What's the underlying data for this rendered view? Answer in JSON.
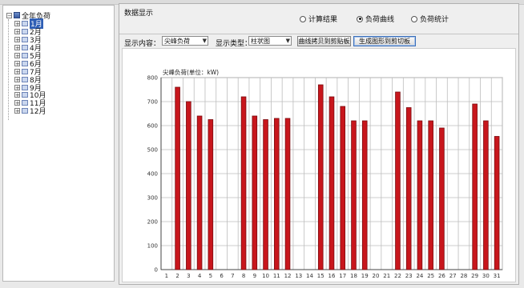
{
  "tree": {
    "root_label": "全年负荷",
    "items": [
      {
        "label": "1月"
      },
      {
        "label": "2月"
      },
      {
        "label": "3月"
      },
      {
        "label": "4月"
      },
      {
        "label": "5月"
      },
      {
        "label": "6月"
      },
      {
        "label": "7月"
      },
      {
        "label": "8月"
      },
      {
        "label": "9月"
      },
      {
        "label": "10月"
      },
      {
        "label": "11月"
      },
      {
        "label": "12月"
      }
    ],
    "selected_index": 0
  },
  "main": {
    "title": "数据显示",
    "radios": [
      {
        "label": "计算结果",
        "checked": false
      },
      {
        "label": "负荷曲线",
        "checked": true
      },
      {
        "label": "负荷统计",
        "checked": false
      }
    ],
    "toolbar": {
      "content_label": "显示内容：",
      "content_value": "尖峰负荷",
      "type_label": "显示类型：",
      "type_value": "柱状图",
      "copy_button": "曲线拷贝到剪贴板",
      "generate_button": "生成图形到剪切板"
    }
  },
  "colors": {
    "bar": "#c8161c",
    "bar_edge": "#7a0c10",
    "grid": "#bdbdbd"
  },
  "chart_data": {
    "type": "bar",
    "ylabel": "尖峰负荷(单位：kW)",
    "ylim": [
      0,
      800
    ],
    "yticks": [
      0,
      100,
      200,
      300,
      400,
      500,
      600,
      700,
      800
    ],
    "categories": [
      "1",
      "2",
      "3",
      "4",
      "5",
      "6",
      "7",
      "8",
      "9",
      "10",
      "11",
      "12",
      "13",
      "14",
      "15",
      "16",
      "17",
      "18",
      "19",
      "20",
      "21",
      "22",
      "23",
      "24",
      "25",
      "26",
      "27",
      "28",
      "29",
      "30",
      "31"
    ],
    "values": [
      0,
      760,
      700,
      640,
      625,
      0,
      0,
      720,
      640,
      625,
      630,
      630,
      0,
      0,
      770,
      720,
      680,
      620,
      620,
      0,
      0,
      740,
      675,
      620,
      620,
      590,
      0,
      0,
      690,
      620,
      555
    ],
    "grid": true,
    "legend": "none"
  }
}
